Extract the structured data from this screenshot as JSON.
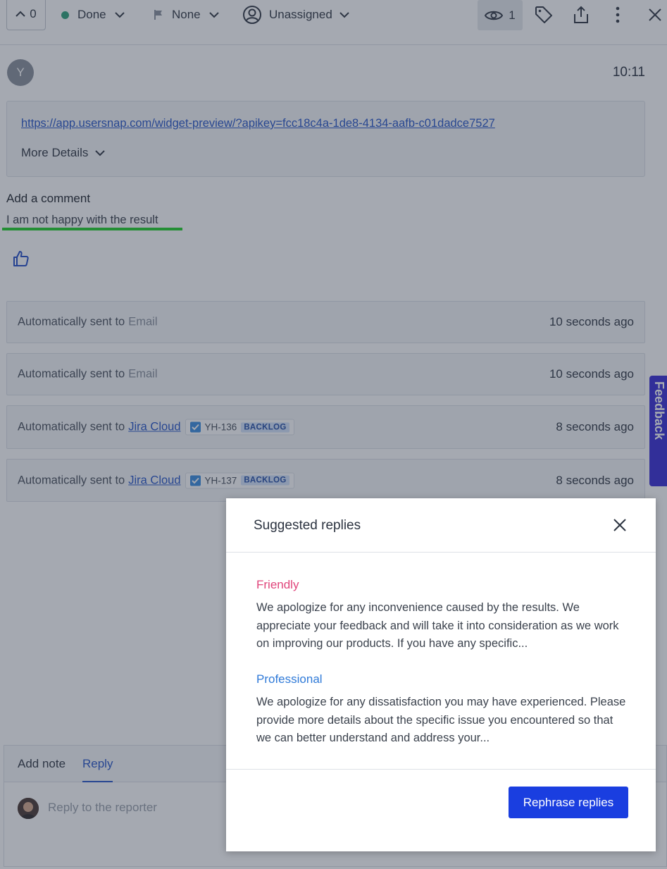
{
  "toolbar": {
    "upvote_count": "0",
    "status_label": "Done",
    "status_color": "#2fa37a",
    "priority_label": "None",
    "assignee_label": "Unassigned",
    "watchers_count": "1",
    "icons": [
      "chevron-up-icon",
      "flag-icon",
      "user-circle-icon",
      "eye-icon",
      "tag-icon",
      "share-icon",
      "more-vertical-icon",
      "close-icon"
    ]
  },
  "header": {
    "avatar_initial": "Y",
    "time": "10:11"
  },
  "details": {
    "url": "https://app.usersnap.com/widget-preview/?apikey=fcc18c4a-1de8-4134-aafb-c01dadce7527",
    "more_details_label": "More Details"
  },
  "comment": {
    "label": "Add a comment",
    "text": "I am not happy with the result"
  },
  "activity": [
    {
      "prefix": "Automatically sent to",
      "target": "Email",
      "time": "10 seconds ago"
    },
    {
      "prefix": "Automatically sent to",
      "target": "Email",
      "time": "10 seconds ago"
    },
    {
      "prefix": "Automatically sent to",
      "target": "Jira Cloud",
      "issue": "YH-136",
      "status": "BACKLOG",
      "time": "8 seconds ago"
    },
    {
      "prefix": "Automatically sent to",
      "target": "Jira Cloud",
      "issue": "YH-137",
      "status": "BACKLOG",
      "time": "8 seconds ago"
    }
  ],
  "feedback_tab": {
    "label": "Feedback",
    "color": "#3a2ed6"
  },
  "reply": {
    "tabs": [
      "Add note",
      "Reply"
    ],
    "active_tab": "Reply",
    "placeholder": "Reply to the reporter"
  },
  "modal": {
    "title": "Suggested replies",
    "suggestions": [
      {
        "type": "Friendly",
        "text": "We apologize for any inconvenience caused by the results. We appreciate your feedback and will take it into consideration as we work on improving our products. If you have any specific..."
      },
      {
        "type": "Professional",
        "text": "We apologize for any dissatisfaction you may have experienced. Please provide more details about the specific issue you encountered so that we can better understand and address your..."
      }
    ],
    "button_label": "Rephrase replies",
    "button_color": "#1a3ee0"
  }
}
